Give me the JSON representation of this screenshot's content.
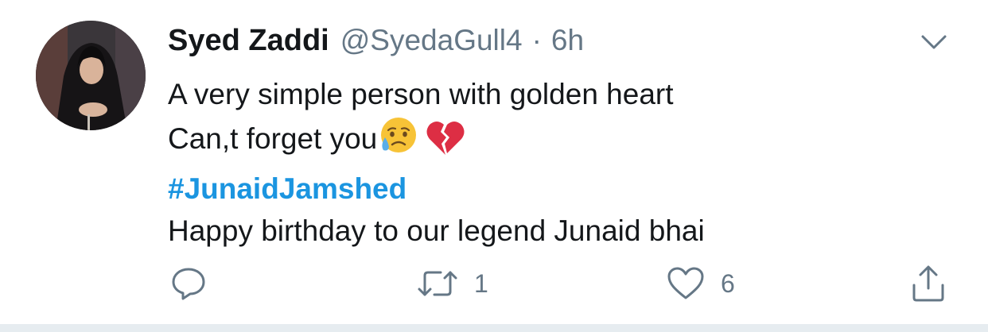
{
  "tweet": {
    "author_name": "Syed Zaddi",
    "author_handle": "@SyedaGull4",
    "separator": "·",
    "time": "6h",
    "lines": [
      "A very simple person with golden heart",
      "Can,t forget you",
      "#JunaidJamshed",
      "Happy birthday to our legend Junaid bhai"
    ],
    "emojis": [
      "disappointed-but-relieved-face",
      "broken-heart"
    ],
    "hashtag_color": "#1b95e0"
  },
  "actions": {
    "reply_icon": "reply-icon",
    "retweet_icon": "retweet-icon",
    "retweet_count": "1",
    "like_icon": "heart-icon",
    "like_count": "6",
    "share_icon": "share-icon"
  },
  "colors": {
    "text": "#14171a",
    "secondary": "#657786",
    "accent": "#1b95e0",
    "divider": "#e6ecf0"
  }
}
